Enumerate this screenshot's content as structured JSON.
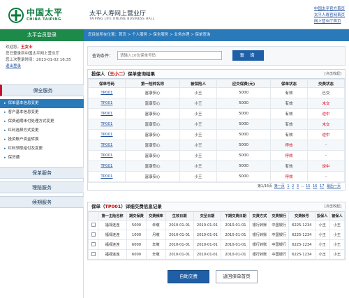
{
  "header": {
    "logo_cn": "中国太平",
    "logo_en": "CHINA TAIPING",
    "hall_cn": "太平人寿网上营业厅",
    "hall_en": "TAIPING LIFE ONLINE BUSINESS HALL",
    "links": [
      "中国太平官方首页",
      "太平人寿官网首页",
      "网上营业厅首页"
    ]
  },
  "left_head": "太平会员登录",
  "breadcrumb": "您目前所在位置：首页 > 个人服务 > 保全服务 > 业务办理 > 保单查询",
  "welcome": {
    "greeting": "欢迎您，",
    "user": "王女士",
    "line2": "您已登录到中国太平网上营业厅",
    "last_login_label": "您上次登录时间：",
    "last_login_time": "2013-01-02 16:35",
    "logout": "退出登录"
  },
  "menu": {
    "group1": "保全服务",
    "items": [
      "保单基本信息变更",
      "客户基本信息变更",
      "保费逾期未付处理方式变更",
      "红利选择方式变更",
      "投资账户资金转换",
      "红利领取给付及变更",
      "保贷通"
    ],
    "group2": "保单服务",
    "group3": "理赔服务",
    "group4": "续期服务"
  },
  "search": {
    "label": "查询条件：",
    "placeholder": "请输入10位保单号码",
    "button": "查 询"
  },
  "policy_panel": {
    "title_prefix": "投保人（",
    "title_name": "王小二",
    "title_suffix": "）保单查询结果",
    "collapse": "[点击收起]",
    "headers": [
      "保单号码",
      "第一险种名称",
      "被保险人",
      "应交保费(元)",
      "保单状态",
      "交费状态"
    ],
    "rows": [
      {
        "no": "TP001",
        "product": "富康安心",
        "insured": "小王",
        "premium": "5000",
        "status": "有效",
        "pay": "已交",
        "status_red": false,
        "pay_red": false
      },
      {
        "no": "TP001",
        "product": "富康安心",
        "insured": "小王",
        "premium": "5000",
        "status": "有效",
        "pay": "未交",
        "status_red": false,
        "pay_red": true
      },
      {
        "no": "TP001",
        "product": "富康安心",
        "insured": "小王",
        "premium": "5000",
        "status": "有效",
        "pay": "逆中",
        "status_red": false,
        "pay_red": true
      },
      {
        "no": "TP001",
        "product": "富康安心",
        "insured": "小王",
        "premium": "5000",
        "status": "有效",
        "pay": "未交",
        "status_red": false,
        "pay_red": true
      },
      {
        "no": "TP001",
        "product": "富康安心",
        "insured": "小王",
        "premium": "5000",
        "status": "有效",
        "pay": "逆中",
        "status_red": false,
        "pay_red": true
      },
      {
        "no": "TP001",
        "product": "富康安心",
        "insured": "小王",
        "premium": "5000",
        "status": "停效",
        "pay": "-",
        "status_red": true,
        "pay_red": false
      },
      {
        "no": "TP001",
        "product": "富康安心",
        "insured": "小王",
        "premium": "5000",
        "status": "停效",
        "pay": "-",
        "status_red": true,
        "pay_red": false
      },
      {
        "no": "TP001",
        "product": "富康安心",
        "insured": "小王",
        "premium": "5000",
        "status": "有效",
        "pay": "逆中",
        "status_red": false,
        "pay_red": true
      },
      {
        "no": "TP001",
        "product": "富康安心",
        "insured": "小王",
        "premium": "5000",
        "status": "停效",
        "pay": "-",
        "status_red": true,
        "pay_red": false
      }
    ],
    "pager": {
      "summary": "第1/16页",
      "first": "第一页",
      "pages": [
        "1",
        "2",
        "3",
        "...",
        "15",
        "16",
        "17"
      ],
      "last": "最后一页"
    }
  },
  "detail_panel": {
    "title_prefix": "保单（",
    "title_no": "TP001",
    "title_suffix": "）详细交费信息记录",
    "collapse": "[点击收起]",
    "headers": [
      "",
      "第一主险名称",
      "期交保费",
      "交费频率",
      "生效日期",
      "交至日期",
      "下期交费日期",
      "交费方式",
      "交费银行",
      "交费帐号",
      "投保人",
      "被保人"
    ],
    "rows": [
      [
        "福禄连连",
        "5000",
        "年缴",
        "2010-01-01",
        "2010-01-01",
        "2010-01-01",
        "银行转账",
        "中国银行",
        "6225-1234",
        "小王",
        "小王"
      ],
      [
        "福禄连连",
        "1000",
        "月缴",
        "2010-01-01",
        "2010-01-01",
        "2010-01-01",
        "银行转账",
        "中国银行",
        "6225-1234",
        "小王",
        "小王"
      ],
      [
        "福禄连连",
        "6000",
        "年缴",
        "2010-01-01",
        "2010-01-01",
        "2010-01-01",
        "银行转账",
        "中国银行",
        "6225-1234",
        "小王",
        "小王"
      ],
      [
        "福禄连连",
        "6000",
        "年缴",
        "2010-01-01",
        "2010-01-01",
        "2010-01-01",
        "银行转账",
        "中国银行",
        "6225-1234",
        "小王",
        "小王"
      ]
    ]
  },
  "actions": {
    "primary": "自助交费",
    "secondary": "返回保单首页"
  },
  "colors": {
    "brand_green": "#1d8a4a",
    "nav_blue": "#2a79b9",
    "button_blue": "#1e5fa8",
    "alert_red": "#d0021b"
  }
}
